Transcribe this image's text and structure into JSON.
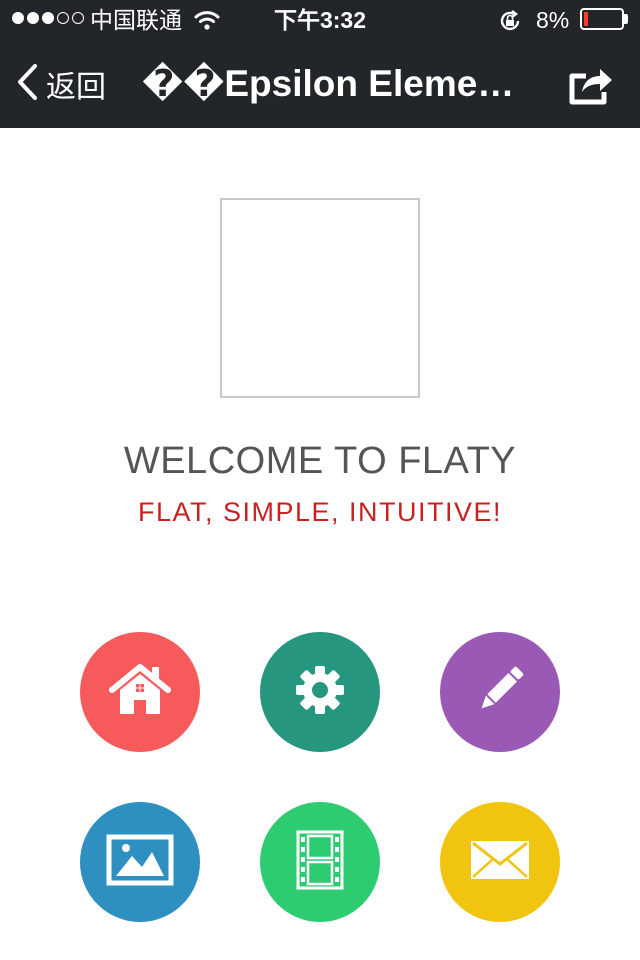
{
  "status_bar": {
    "carrier": "中国联通",
    "time": "下午3:32",
    "battery_percent": "8%",
    "battery_level": 0.08,
    "signal_bars_filled": 3,
    "signal_bars_total": 5
  },
  "nav": {
    "back_label": "返回",
    "title": "��Epsilon Elements",
    "back_icon": "chevron-left-icon",
    "share_icon": "share-icon"
  },
  "content": {
    "welcome": "WELCOME TO FLATY",
    "tagline": "FLAT, SIMPLE, INTUITIVE!"
  },
  "tiles": [
    {
      "icon": "home-icon",
      "color": "#f75a5a"
    },
    {
      "icon": "gear-icon",
      "color": "#26967e"
    },
    {
      "icon": "pencil-icon",
      "color": "#9b59b6"
    },
    {
      "icon": "image-icon",
      "color": "#2e8fc1"
    },
    {
      "icon": "film-icon",
      "color": "#2ecc71"
    },
    {
      "icon": "mail-icon",
      "color": "#f1c40f"
    }
  ],
  "colors": {
    "nav_background": "#222629",
    "welcome_text": "#555555",
    "tagline_text": "#c82121"
  }
}
